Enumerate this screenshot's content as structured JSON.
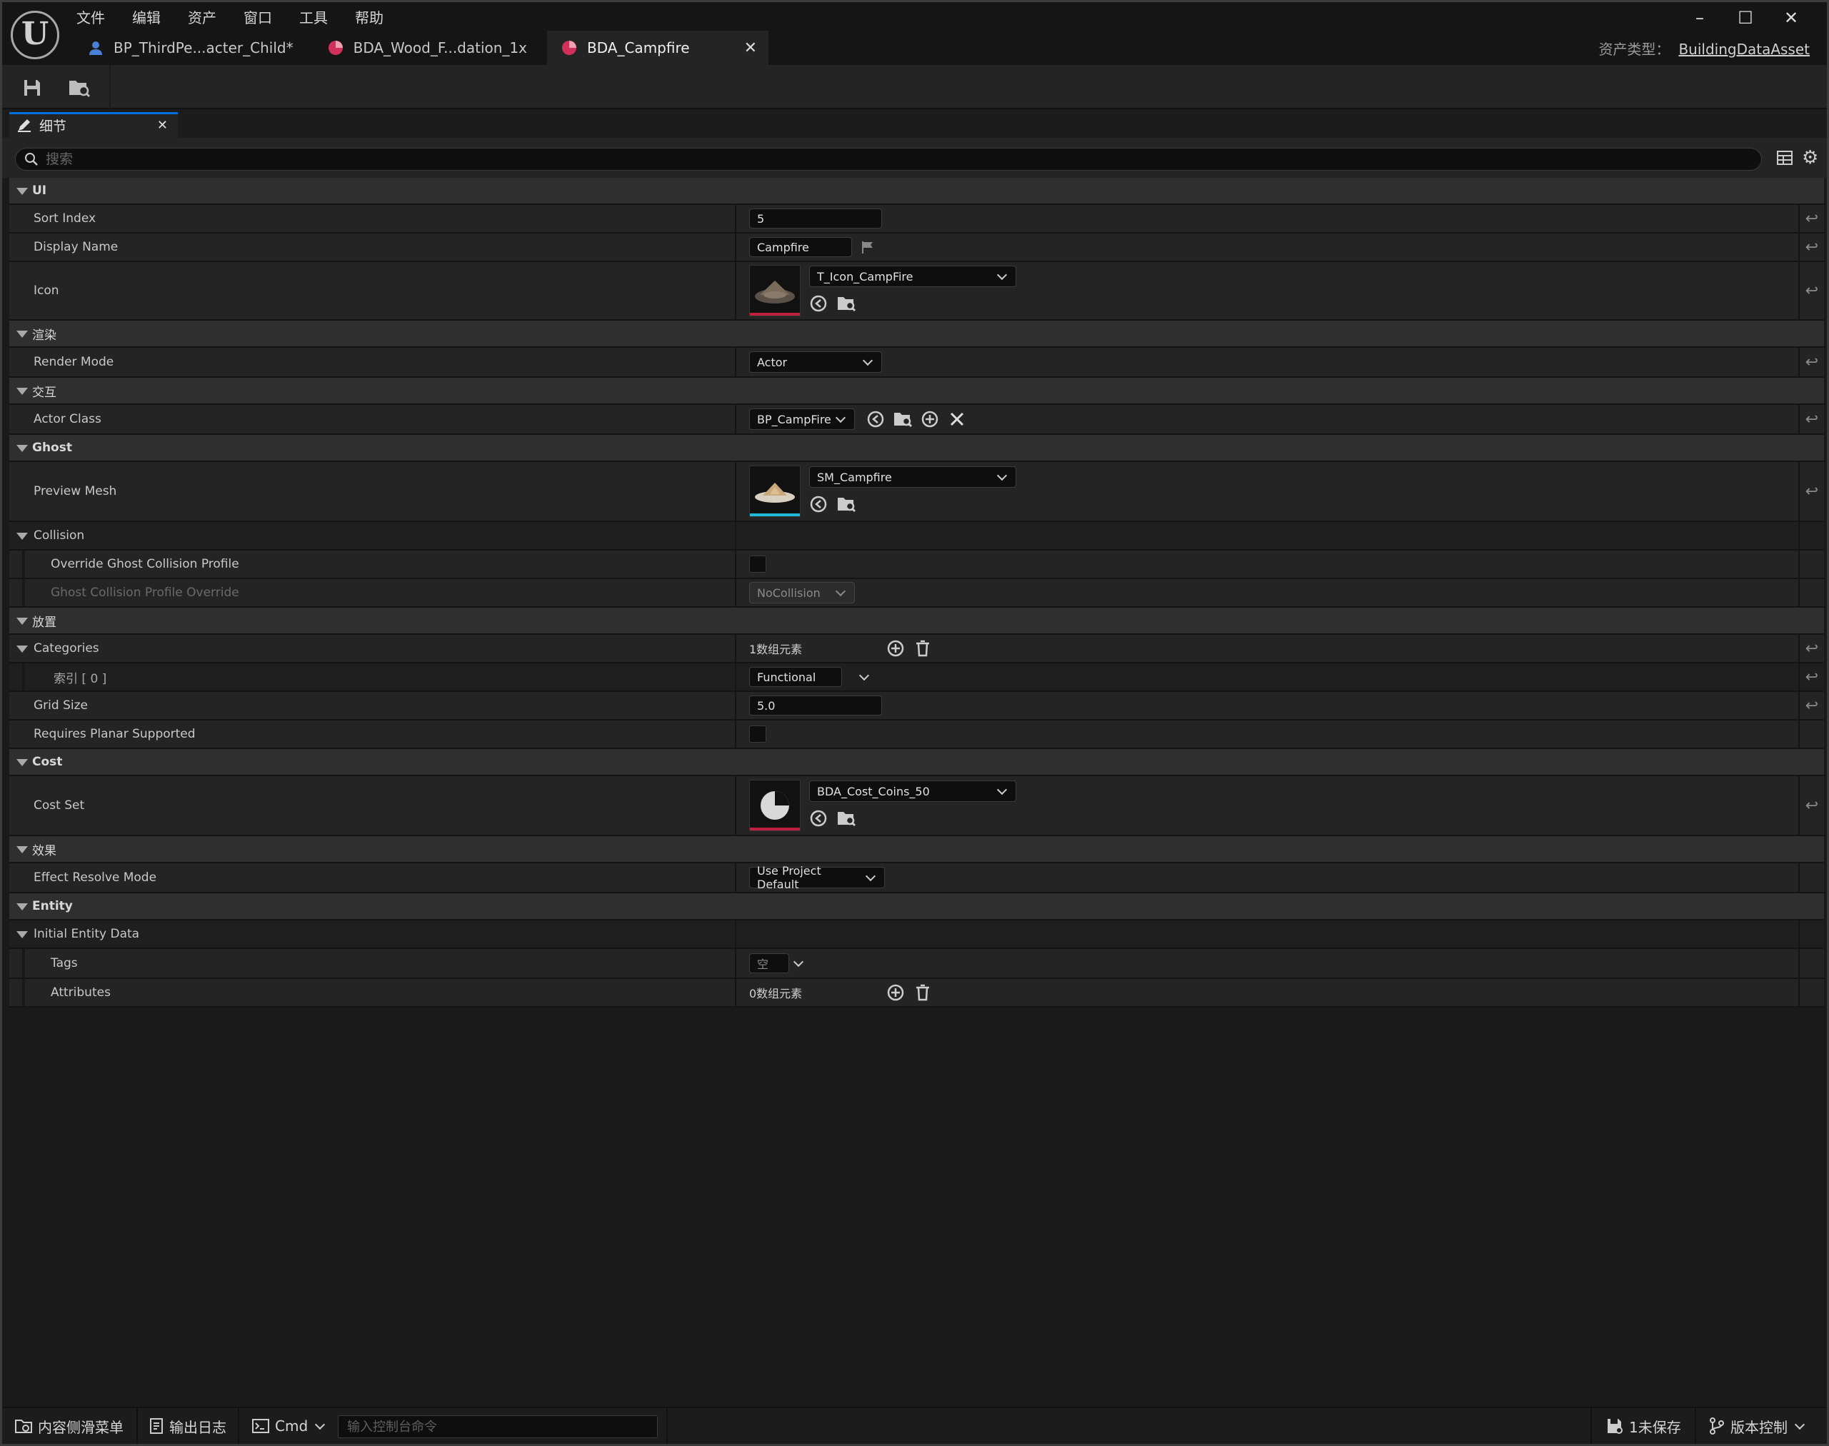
{
  "menu": [
    "文件",
    "编辑",
    "资产",
    "窗口",
    "工具",
    "帮助"
  ],
  "doc_tabs": [
    {
      "label": "BP_ThirdPe...acter_Child*",
      "icon": "character-icon"
    },
    {
      "label": "BDA_Wood_F...dation_1x",
      "icon": "data-asset-icon"
    },
    {
      "label": "BDA_Campfire",
      "icon": "data-asset-icon",
      "active": true
    }
  ],
  "asset_type_label": "资产类型：",
  "asset_type_value": "BuildingDataAsset",
  "panel_tab": "细节",
  "search_placeholder": "搜索",
  "details": {
    "ui": "UI",
    "sort_index": {
      "label": "Sort Index",
      "value": "5"
    },
    "display_name": {
      "label": "Display Name",
      "value": "Campfire"
    },
    "icon": {
      "label": "Icon",
      "value": "T_Icon_CampFire"
    },
    "render_cat": "渲染",
    "render_mode": {
      "label": "Render Mode",
      "value": "Actor"
    },
    "interact_cat": "交互",
    "actor_class": {
      "label": "Actor Class",
      "value": "BP_CampFire"
    },
    "ghost_cat": "Ghost",
    "preview_mesh": {
      "label": "Preview Mesh",
      "value": "SM_Campfire"
    },
    "collision": "Collision",
    "override_ghost": {
      "label": "Override Ghost Collision Profile"
    },
    "ghost_profile": {
      "label": "Ghost Collision Profile Override",
      "value": "NoCollision"
    },
    "place_cat": "放置",
    "categories": {
      "label": "Categories",
      "value": "1数组元素"
    },
    "index0": {
      "label": "索引 [ 0 ]",
      "value": "Functional"
    },
    "grid_size": {
      "label": "Grid Size",
      "value": "5.0"
    },
    "planar": {
      "label": "Requires Planar Supported"
    },
    "cost_cat": "Cost",
    "cost_set": {
      "label": "Cost Set",
      "value": "BDA_Cost_Coins_50"
    },
    "effect_cat": "效果",
    "effect_mode": {
      "label": "Effect Resolve Mode",
      "value": "Use Project Default"
    },
    "entity_cat": "Entity",
    "initial_entity": {
      "label": "Initial Entity Data"
    },
    "tags": {
      "label": "Tags",
      "value": "空"
    },
    "attributes": {
      "label": "Attributes",
      "value": "0数组元素"
    }
  },
  "status": {
    "content_drawer": "内容侧滑菜单",
    "output_log": "输出日志",
    "cmd": "Cmd",
    "console_placeholder": "输入控制台命令",
    "unsaved": "1未保存",
    "source_control": "版本控制"
  },
  "colors": {
    "accent": "#0070e0",
    "tab_icon_red": "#d0305a",
    "thumb_red": "#c02040",
    "thumb_cyan": "#20b8d8"
  }
}
